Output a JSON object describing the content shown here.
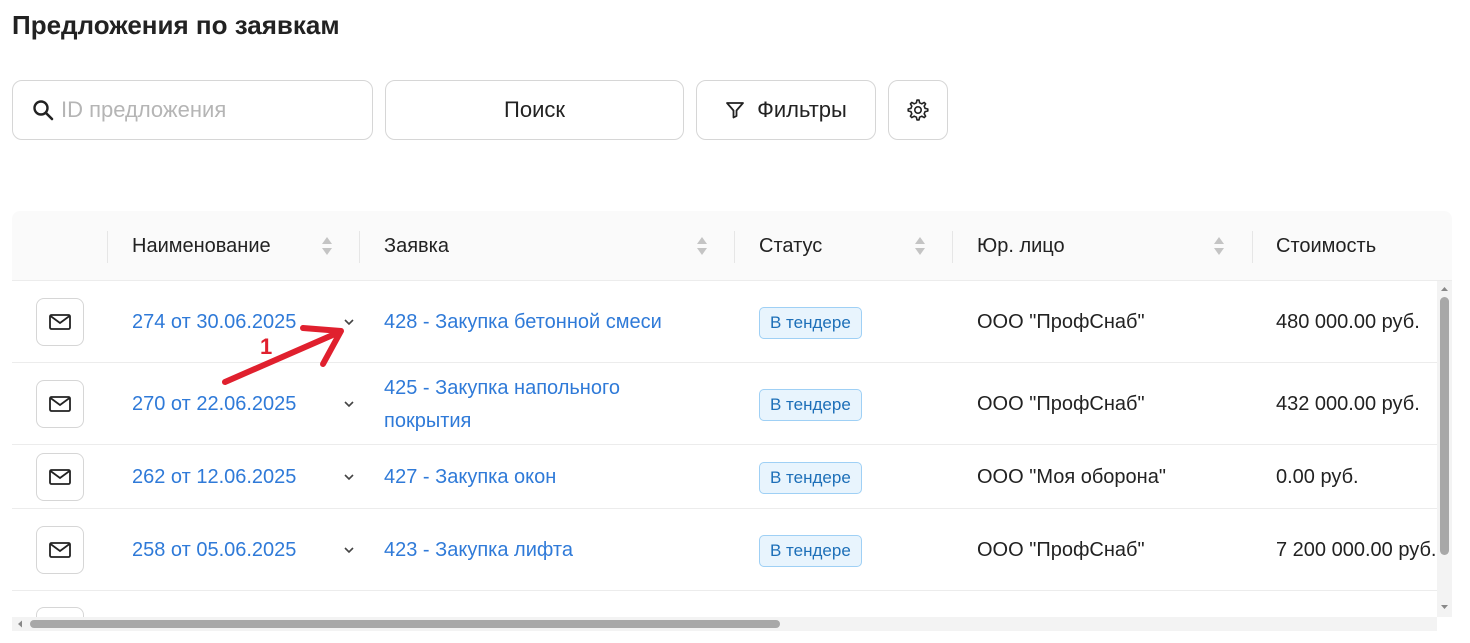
{
  "page": {
    "title": "Предложения по заявкам"
  },
  "toolbar": {
    "search_placeholder": "ID предложения",
    "search_button": "Поиск",
    "filters_button": "Фильтры"
  },
  "table": {
    "columns": [
      "Наименование",
      "Заявка",
      "Статус",
      "Юр. лицо",
      "Стоимость"
    ],
    "rows": [
      {
        "name": "274 от 30.06.2025",
        "request": "428 - Закупка бетонной смеси",
        "request_lines": [
          "428 - Закупка бетонной смеси"
        ],
        "status": "В тендере",
        "entity": "ООО \"ПрофСнаб\"",
        "cost": "480 000.00 руб."
      },
      {
        "name": "270 от 22.06.2025",
        "request": "425 - Закупка напольного покрытия",
        "request_lines": [
          "425 - Закупка напольного",
          "покрытия"
        ],
        "status": "В тендере",
        "entity": "ООО \"ПрофСнаб\"",
        "cost": "432 000.00 руб."
      },
      {
        "name": "262 от 12.06.2025",
        "request": "427 - Закупка окон",
        "request_lines": [
          "427 - Закупка окон"
        ],
        "status": "В тендере",
        "entity": "ООО \"Моя оборона\"",
        "cost": "0.00 руб."
      },
      {
        "name": "258 от 05.06.2025",
        "request": "423 - Закупка лифта",
        "request_lines": [
          "423 - Закупка лифта"
        ],
        "status": "В тендере",
        "entity": "ООО \"ПрофСнаб\"",
        "cost": "7 200 000.00 руб."
      }
    ]
  },
  "annotation": {
    "label": "1",
    "color": "#e0202e"
  },
  "colors": {
    "link": "#2f7ad8",
    "badge_bg": "#e8f4fd",
    "badge_border": "#9fd0f5",
    "badge_text": "#1d6fb8"
  }
}
